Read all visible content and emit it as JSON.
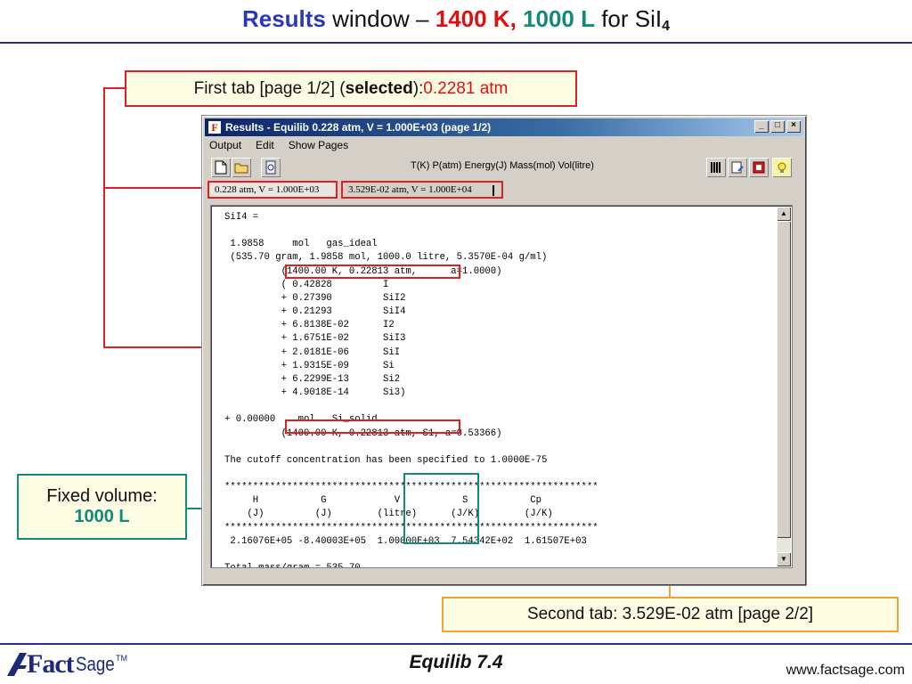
{
  "slide": {
    "title_part1": "Results",
    "title_part2": " window – ",
    "title_temp": "1400 K",
    "title_comma": ",",
    "title_vol": " 1000 L",
    "title_part3": " for SiI",
    "title_sub": "4",
    "footer_center": "Equilib  7.4",
    "footer_url": "www.factsage.com",
    "logo_fact": "Fact",
    "logo_sage": "Sage",
    "logo_tm": "TM"
  },
  "callouts": {
    "first_prefix": "First tab [page 1/2] (",
    "first_selected": "selected",
    "first_mid": "): ",
    "first_value": "0.2281 atm",
    "fixed_line1": "Fixed volume:",
    "fixed_value": "1000 L",
    "second_text": "Second tab: 3.529E-02 atm [page 2/2]"
  },
  "window": {
    "title": "Results - Equilib  0.228 atm, V = 1.000E+03   (page 1/2)",
    "app_icon_letter": "F",
    "controls": {
      "minimize": "_",
      "maximize": "□",
      "close": "×"
    },
    "menu": [
      "Output",
      "Edit",
      "Show Pages"
    ],
    "toolbar_left_icons": [
      "new-page-icon",
      "open-folder-icon",
      "print-preview-icon"
    ],
    "toolbar_units": "T(K)  P(atm)  Energy(J)  Mass(mol)  Vol(litre)",
    "toolbar_right_icons": [
      "fork-knife-icon",
      "edit-page-icon",
      "bookmark-icon",
      "lightbulb-icon"
    ],
    "tabs": [
      {
        "label": "0.228 atm, V = 1.000E+03",
        "selected": true
      },
      {
        "label": "3.529E-02 atm, V = 1.000E+04",
        "selected": false
      }
    ],
    "results_lines": [
      "SiI4 =",
      "",
      " 1.9858     mol   gas_ideal",
      " (535.70 gram, 1.9858 mol, 1000.0 litre, 5.3570E-04 g/ml)",
      "          (1400.00 K, 0.22813 atm,      a=1.0000)",
      "          ( 0.42828         I",
      "          + 0.27390         SiI2",
      "          + 0.21293         SiI4",
      "          + 6.8138E-02      I2",
      "          + 1.6751E-02      SiI3",
      "          + 2.0181E-06      SiI",
      "          + 1.9315E-09      Si",
      "          + 6.2299E-13      Si2",
      "          + 4.9018E-14      Si3)",
      "",
      "+ 0.00000    mol   Si_solid",
      "          (1400.00 K, 0.22813 atm, S1, a=0.53366)",
      "",
      "The cutoff concentration has been specified to 1.0000E-75",
      "",
      "******************************************************************",
      "     H           G            V           S           Cp",
      "    (J)         (J)        (litre)      (J/K)        (J/K)",
      "******************************************************************",
      " 2.16076E+05 -8.40003E+05  1.00000E+03  7.54342E+02  1.61507E+03",
      "",
      "Total mass/gram = 535.70"
    ]
  },
  "colors": {
    "title_blue": "#2b38b8",
    "highlight_red": "#e02020",
    "highlight_teal": "#128a7a",
    "highlight_orange": "#f3a42d",
    "callout_fill": "#fdfde3"
  }
}
